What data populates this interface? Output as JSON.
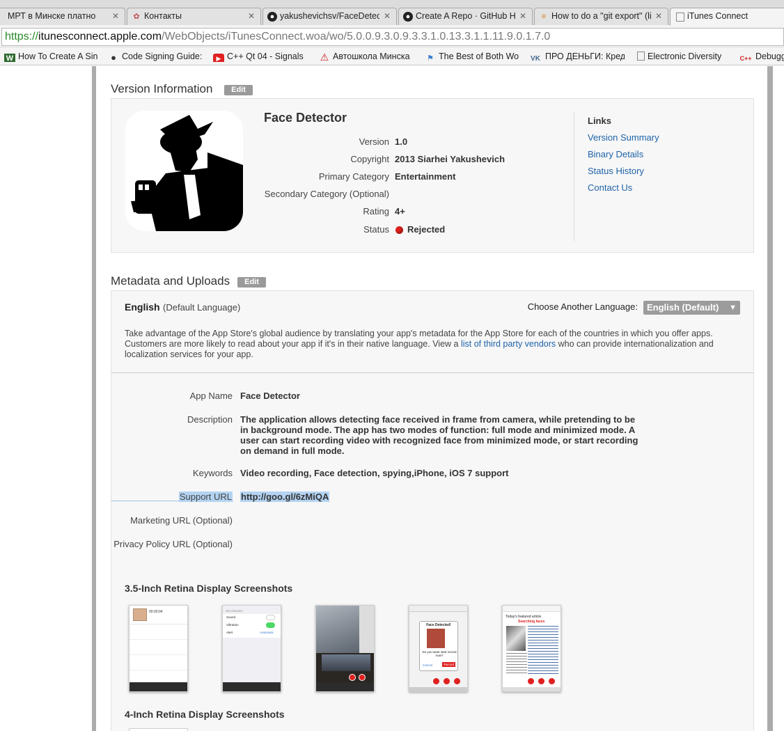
{
  "browser": {
    "tabs": [
      {
        "title": "МРТ в Минске платно",
        "active": false
      },
      {
        "title": "Контакты",
        "active": false
      },
      {
        "title": "yakushevichsv/FaceDetect",
        "active": false
      },
      {
        "title": "Create A Repo · GitHub He",
        "active": false
      },
      {
        "title": "How to do a \"git export\" (li",
        "active": false
      },
      {
        "title": "iTunes Connect",
        "active": true
      }
    ],
    "url_scheme": "https://",
    "url_host": "itunesconnect.apple.com",
    "url_path": "/WebObjects/iTunesConnect.woa/wo/5.0.0.9.3.0.9.3.3.1.0.13.3.1.1.11.9.0.1.7.0",
    "bookmarks": [
      {
        "label": "How To Create A Sin",
        "icon": "w-icon"
      },
      {
        "label": "Code Signing Guide:",
        "icon": "apple-icon"
      },
      {
        "label": "C++ Qt 04 - Signals",
        "icon": "youtube-icon"
      },
      {
        "label": "Автошкола Минска",
        "icon": "warning-icon"
      },
      {
        "label": "The Best of Both Wo",
        "icon": "flag-icon"
      },
      {
        "label": "ПРО ДЕНЬГИ: Креди",
        "icon": "vk-icon"
      },
      {
        "label": "Electronic Diversity",
        "icon": "page-icon"
      },
      {
        "label": "Debugg",
        "icon": "cpp-icon"
      }
    ]
  },
  "version_info": {
    "heading": "Version Information",
    "edit_label": "Edit",
    "app_title": "Face Detector",
    "fields": [
      {
        "label": "Version",
        "value": "1.0"
      },
      {
        "label": "Copyright",
        "value": "2013 Siarhei Yakushevich"
      },
      {
        "label": "Primary Category",
        "value": "Entertainment"
      },
      {
        "label": "Secondary Category (Optional)",
        "value": ""
      },
      {
        "label": "Rating",
        "value": "4+"
      },
      {
        "label": "Status",
        "value": "Rejected"
      }
    ],
    "status_color": "#e0211a",
    "links_heading": "Links",
    "links": [
      "Version Summary",
      "Binary Details",
      "Status History",
      "Contact Us"
    ]
  },
  "metadata": {
    "heading": "Metadata and Uploads",
    "edit_label": "Edit",
    "language": "English",
    "language_note": "(Default Language)",
    "choose_label": "Choose Another Language:",
    "selected_language": "English (Default)",
    "intro_before": "Take advantage of the App Store's global audience by translating your app's metadata for the App Store for each of the countries in which you offer apps. Customers are more likely to read about your app if it's in their native language. View a ",
    "intro_link": "list of third party vendors",
    "intro_after": " who can provide internationalization and localization services for your app.",
    "app_name_label": "App Name",
    "app_name": "Face Detector",
    "description_label": "Description",
    "description": "The application allows detecting face received in frame from camera, while pretending to be in background mode. The app has two modes of function: full mode and minimized mode. A user can start recording video with recognized face from minimized mode, or start recording on demand in full mode.",
    "keywords_label": "Keywords",
    "keywords": "Video recording, Face detection, spying,iPhone, iOS 7 support",
    "support_url_label": "Support URL",
    "support_url": "http://goo.gl/6zMiQA",
    "marketing_url_label": "Marketing URL (Optional)",
    "privacy_url_label": "Privacy Policy URL (Optional)"
  },
  "screenshots": {
    "heading_35": "3.5-Inch Retina Display Screenshots",
    "heading_4": "4-Inch Retina Display Screenshots",
    "shot1_time": "00:00:04",
    "shot2_rows": [
      "RECORDING",
      "Sound",
      "Vibration",
      "Alert",
      "Automatic"
    ],
    "shot4_title": "Face Detected!",
    "shot4_question": "Do you want start record now?",
    "shot4_cancel": "Cancel",
    "shot4_record": "Record",
    "shot5_heading": "Today's featured article",
    "shot5_status": "Searching faces"
  },
  "colors": {
    "link": "#1f63a8",
    "edit_button": "#9a9a9a",
    "selection": "#b4d3f2"
  }
}
